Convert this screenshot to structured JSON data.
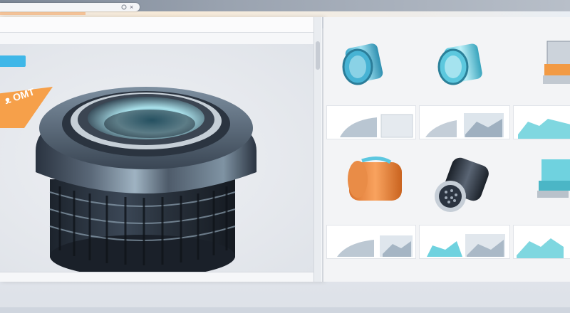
{
  "browser": {
    "tab_url": "",
    "icons": [
      "lock-icon",
      "close-icon"
    ]
  },
  "menubar": {
    "items": [
      "",
      "",
      "",
      "",
      "",
      "",
      "",
      "",
      "",
      "",
      "",
      "",
      "",
      "",
      ""
    ]
  },
  "canvas": {
    "ribbon_text": "ᴥ OMT",
    "accent_blue": "#3fb7e8",
    "accent_orange": "#f6a04a"
  },
  "statusbar": {
    "items": [
      "",
      "",
      "",
      "",
      "",
      ""
    ]
  },
  "gallery": {
    "rows": [
      {
        "products": [
          "blue-cylinder-icon",
          "teal-cylinder-icon",
          "steel-block-icon"
        ],
        "thumbs": [
          {
            "label": "",
            "label2": ""
          },
          {
            "label": "",
            "label2": ""
          },
          {
            "label": ""
          }
        ]
      },
      {
        "products": [
          "orange-bucket-icon",
          "connector-icon",
          "teal-block-icon"
        ],
        "thumbs": [
          {
            "label": "",
            "label2": ""
          },
          {
            "label": "",
            "label2": ""
          },
          {
            "label": ""
          }
        ]
      }
    ]
  }
}
